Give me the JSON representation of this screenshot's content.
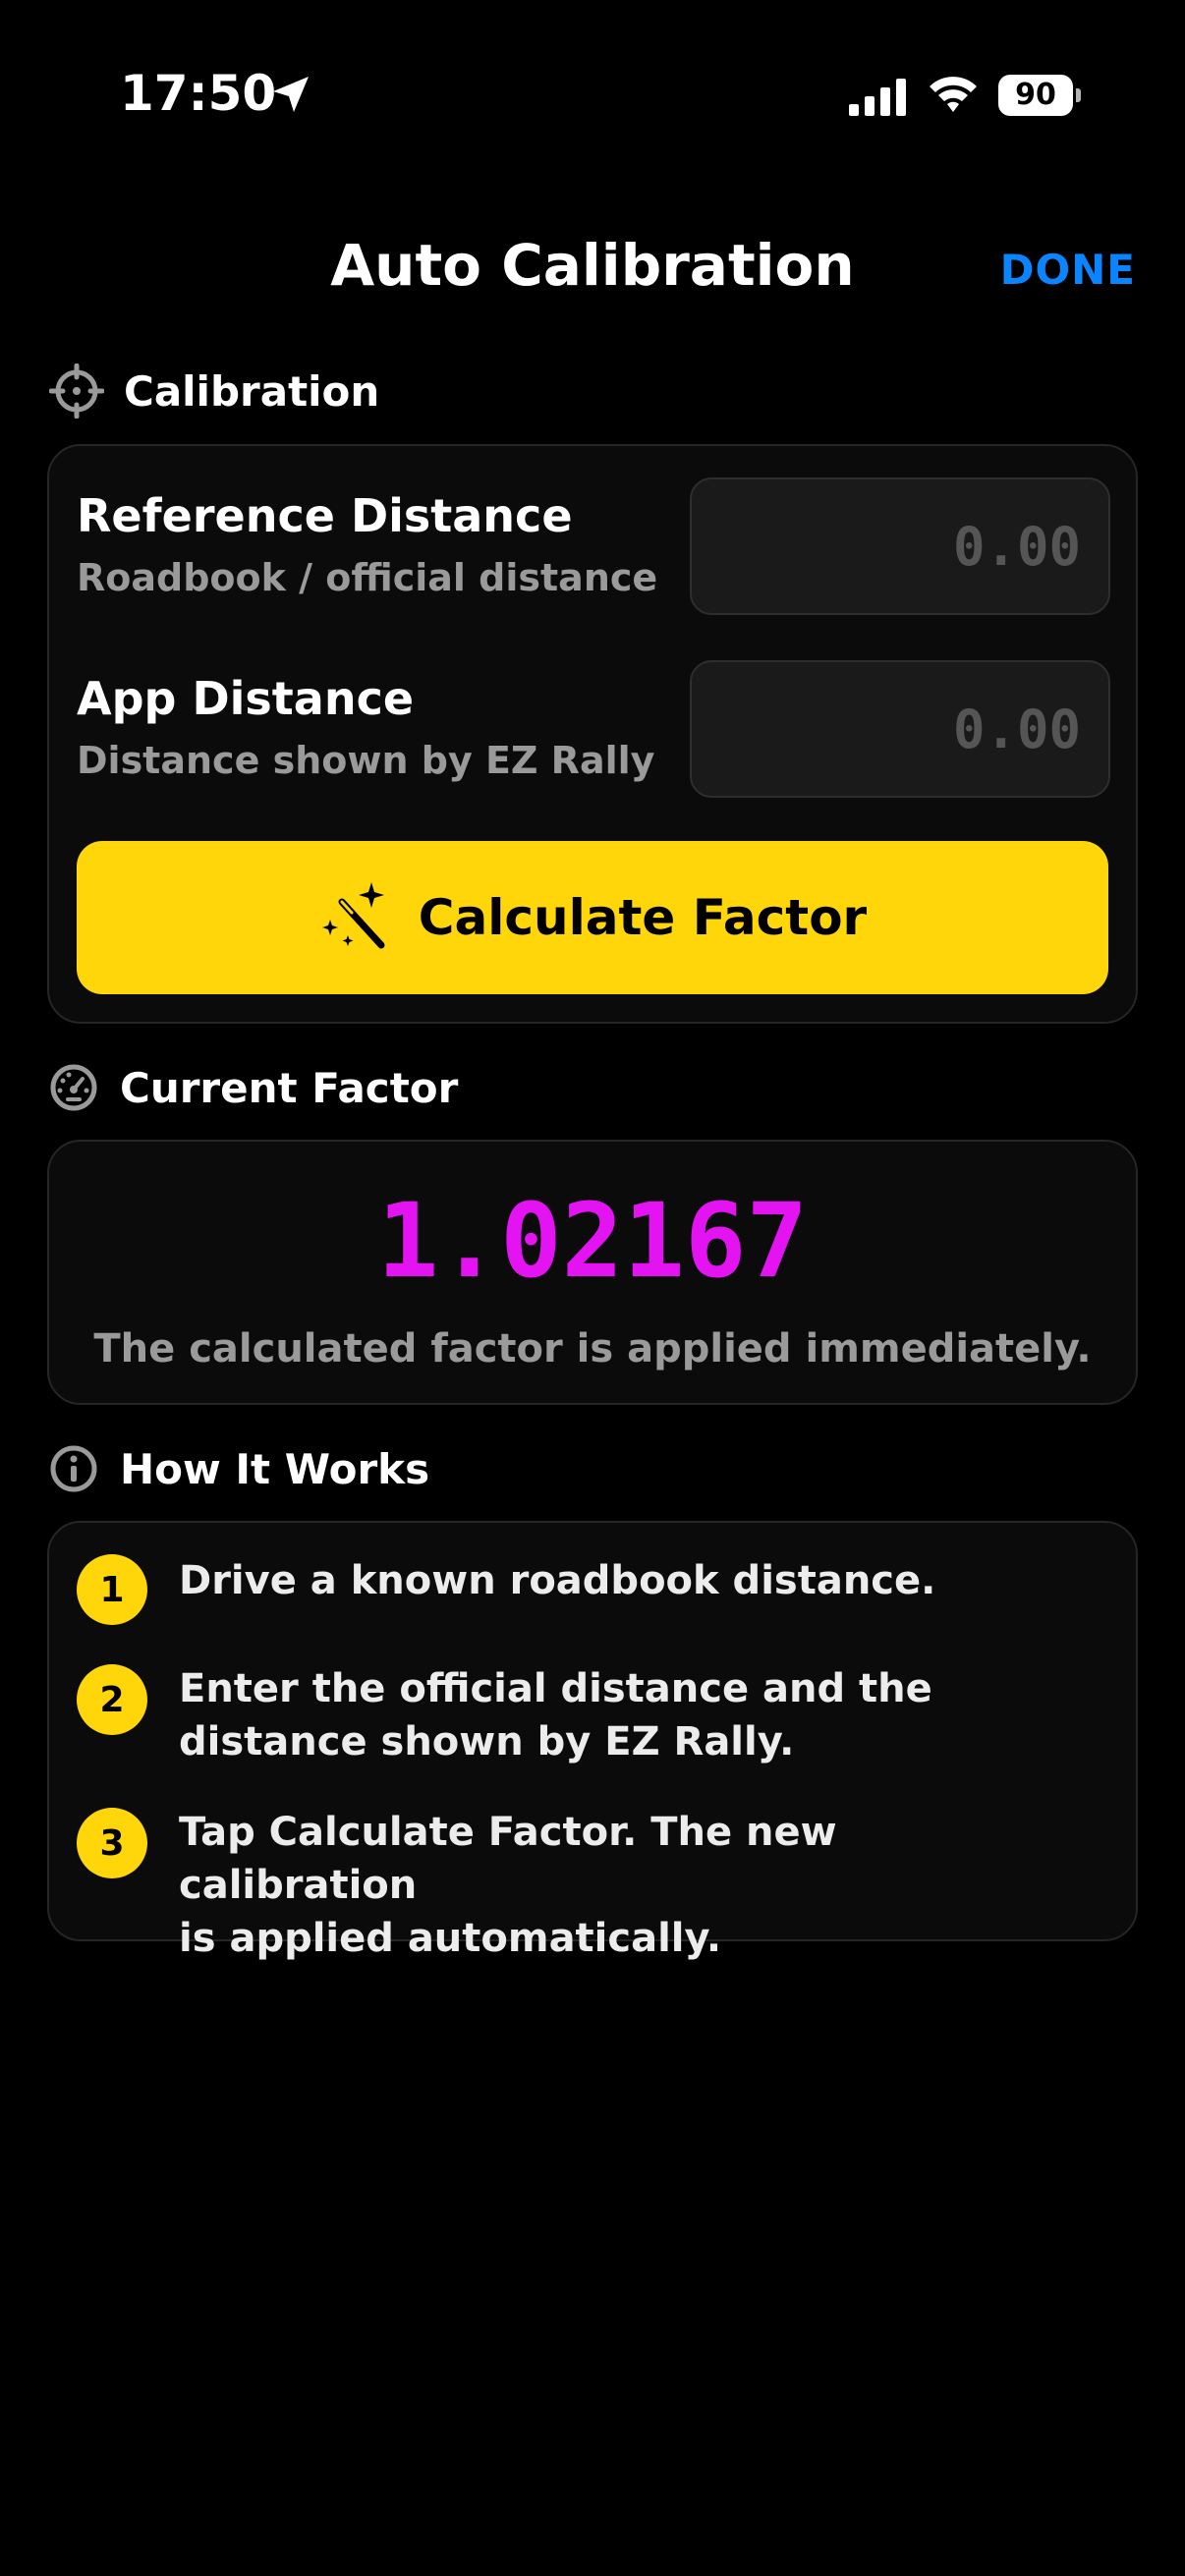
{
  "status_bar": {
    "time": "17:50",
    "battery": "90",
    "icons": [
      "location-arrow-icon",
      "signal-icon",
      "wifi-icon",
      "battery-icon"
    ]
  },
  "header": {
    "title": "Auto Calibration",
    "done_label": "DONE",
    "accent_color": "#0a84ff"
  },
  "calibration": {
    "section_label": "Calibration",
    "section_icon": "crosshair-icon",
    "reference": {
      "title": "Reference Distance",
      "subtitle": "Roadbook / official distance",
      "value": "",
      "placeholder": "0.00"
    },
    "app": {
      "title": "App Distance",
      "subtitle": "Distance shown by EZ Rally",
      "value": "",
      "placeholder": "0.00"
    },
    "button_label": "Calculate Factor",
    "button_icon": "magic-wand-icon",
    "button_color": "#ffd60a"
  },
  "current_factor": {
    "section_label": "Current Factor",
    "section_icon": "gauge-icon",
    "value": "1.02167",
    "value_color": "#e413f2",
    "note": "The calculated factor is applied immediately."
  },
  "how_it_works": {
    "section_label": "How It Works",
    "section_icon": "info-icon",
    "steps": [
      {
        "number": "1",
        "line1": "Drive a known roadbook distance.",
        "line2": ""
      },
      {
        "number": "2",
        "line1": "Enter the official distance and the",
        "line2": "distance shown by EZ Rally."
      },
      {
        "number": "3",
        "line1": "Tap Calculate Factor. The new calibration",
        "line2": "is applied automatically."
      }
    ]
  }
}
